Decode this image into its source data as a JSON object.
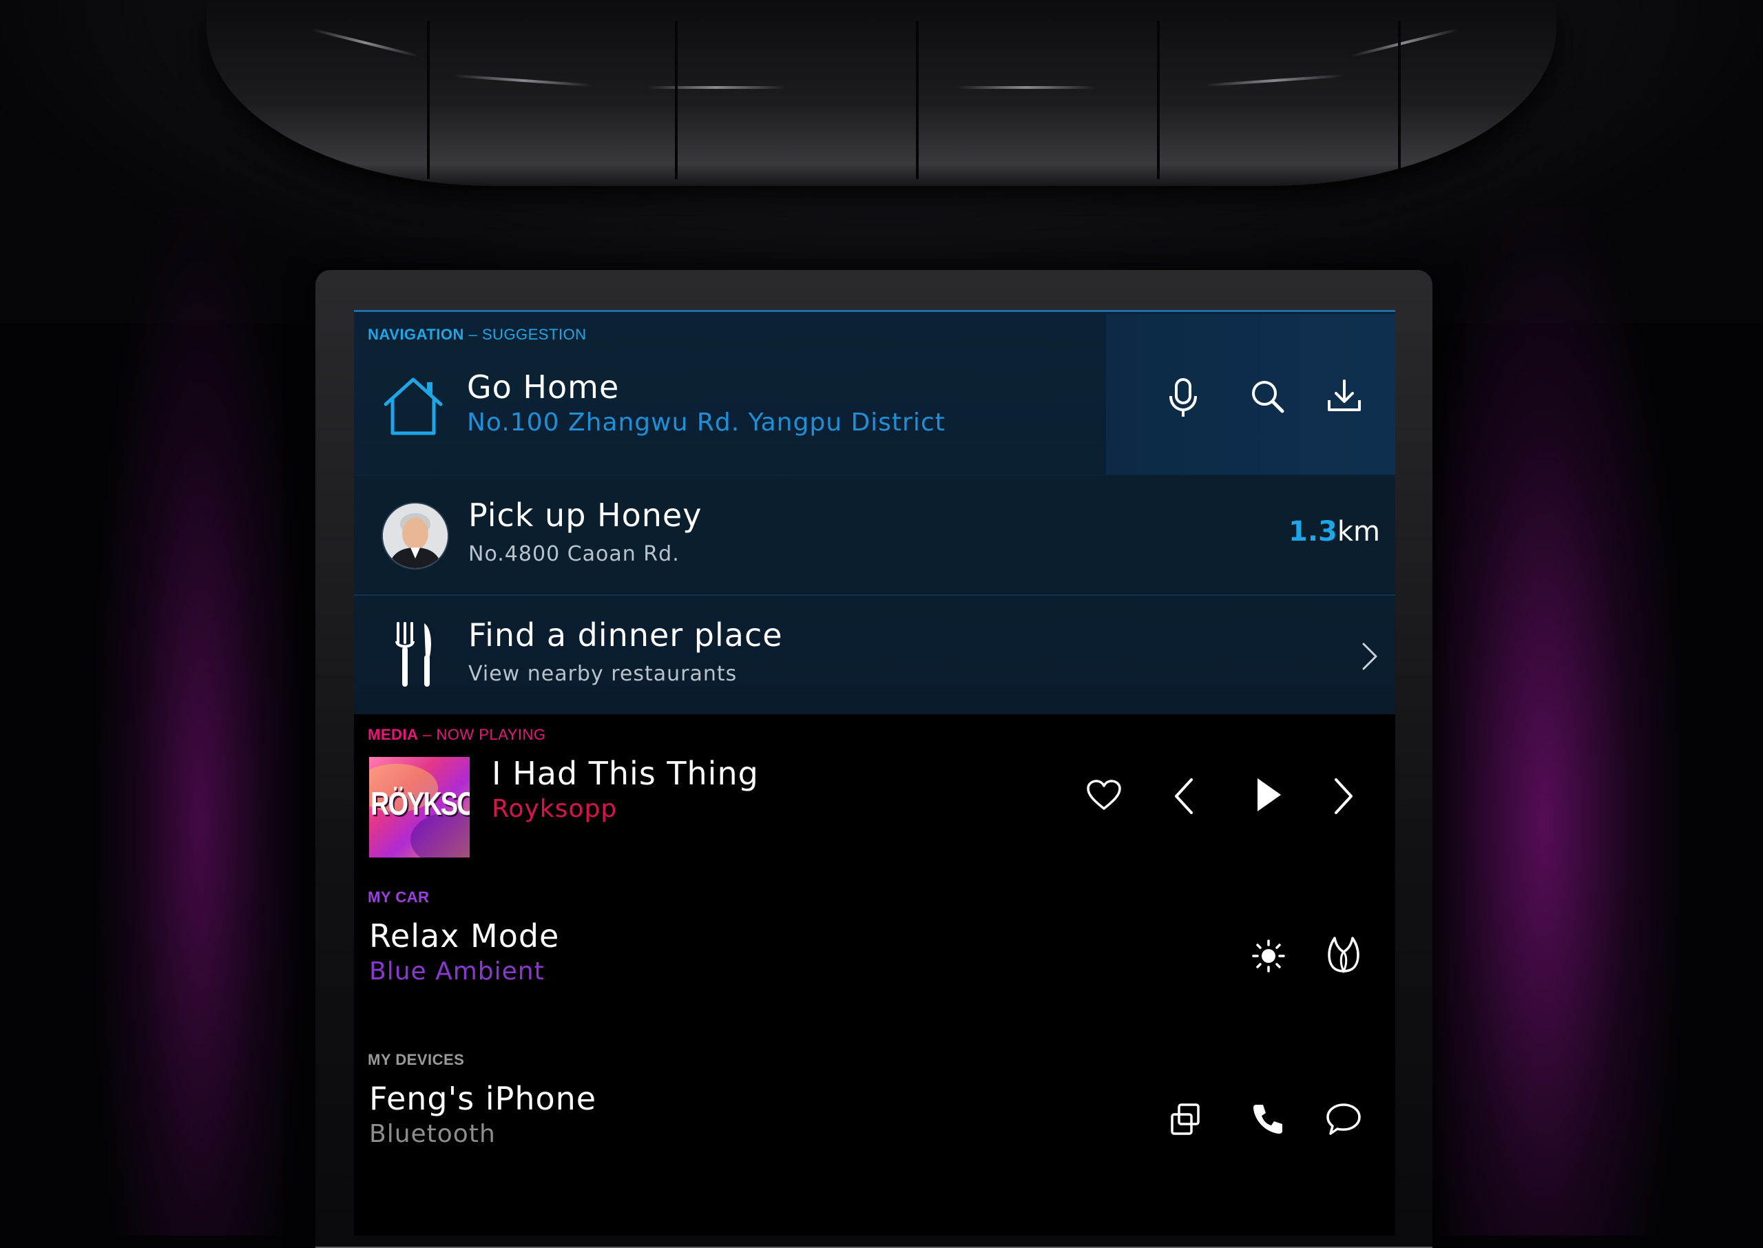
{
  "navigation": {
    "section_title": "NAVIGATION",
    "section_sub": "– SUGGESTION",
    "home": {
      "title": "Go Home",
      "address": "No.100 Zhangwu Rd. Yangpu District"
    },
    "actions": [
      "mic-icon",
      "search-icon",
      "download-icon"
    ],
    "pickup": {
      "title": "Pick up Honey",
      "address": "No.4800 Caoan Rd.",
      "distance_value": "1.3",
      "distance_unit": "km"
    },
    "dinner": {
      "title": "Find a dinner place",
      "subtitle": "View nearby restaurants"
    }
  },
  "media": {
    "section_title": "MEDIA",
    "section_sub": "– NOW PLAYING",
    "track": "I Had This Thing",
    "artist": "Royksopp",
    "album_text": "RÖYKSOPP"
  },
  "car": {
    "section_title": "MY CAR",
    "mode": "Relax Mode",
    "ambient": "Blue Ambient"
  },
  "devices": {
    "section_title": "MY DEVICES",
    "device": "Feng's iPhone",
    "connection": "Bluetooth"
  },
  "colors": {
    "nav_accent": "#1fa6e6",
    "media_accent": "#e8157a",
    "car_accent": "#9a3fe0",
    "devices_accent": "#9a9a9a"
  }
}
